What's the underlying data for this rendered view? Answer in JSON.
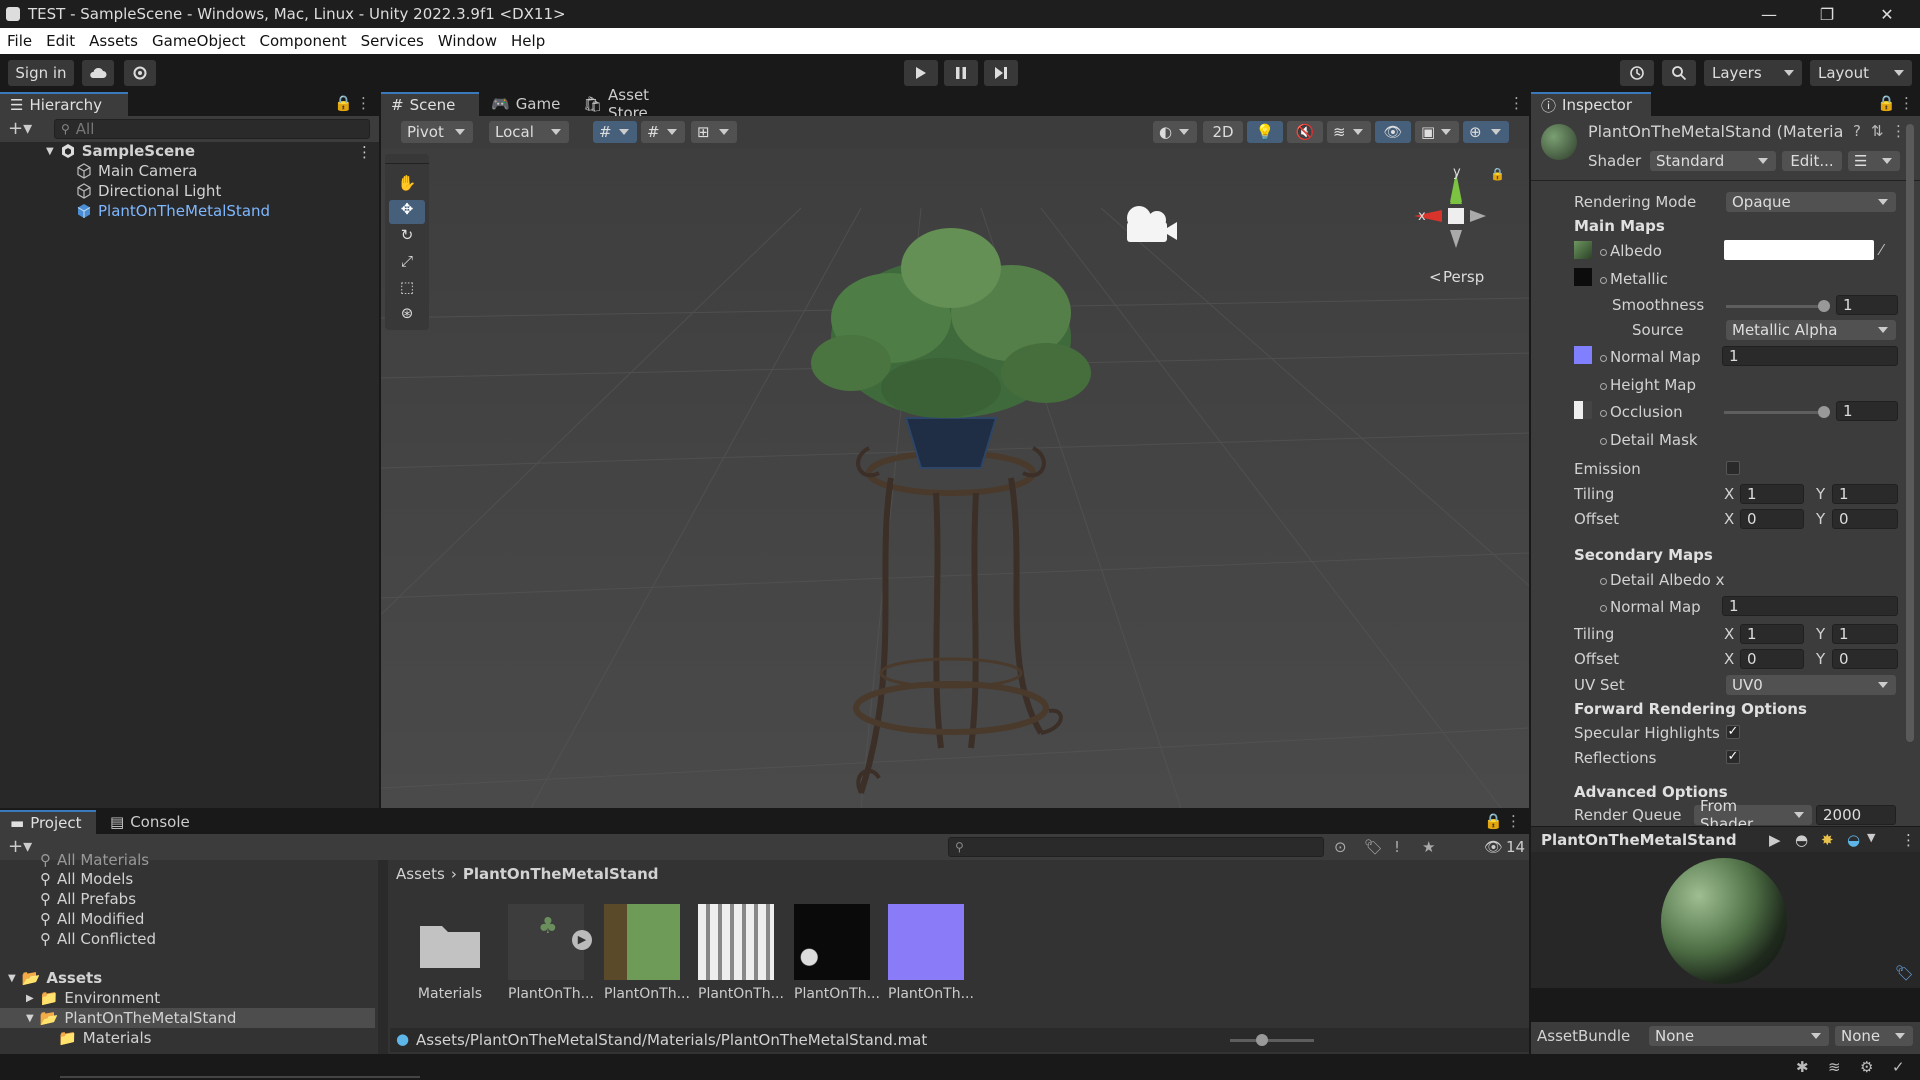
{
  "window": {
    "title": "TEST - SampleScene - Windows, Mac, Linux - Unity 2022.3.9f1 <DX11>",
    "minimize": "—",
    "maximize": "❐",
    "close": "✕"
  },
  "menu": [
    "File",
    "Edit",
    "Assets",
    "GameObject",
    "Component",
    "Services",
    "Window",
    "Help"
  ],
  "toolbar": {
    "sign_in": "Sign in",
    "layers": "Layers",
    "layout": "Layout"
  },
  "hierarchy": {
    "tab": "Hierarchy",
    "search_placeholder": "All",
    "scene": "SampleScene",
    "items": [
      "Main Camera",
      "Directional Light",
      "PlantOnTheMetalStand"
    ]
  },
  "scene": {
    "tabs": [
      "Scene",
      "Game",
      "Asset Store"
    ],
    "pivot": "Pivot",
    "local": "Local",
    "toggle_2d": "2D",
    "persp": "Persp",
    "axis_y": "y",
    "axis_x": "x"
  },
  "inspector": {
    "tab": "Inspector",
    "material_name": "PlantOnTheMetalStand (Materia",
    "shader_label": "Shader",
    "shader_value": "Standard",
    "edit_button": "Edit...",
    "rendering_mode_label": "Rendering Mode",
    "rendering_mode_value": "Opaque",
    "main_maps": "Main Maps",
    "albedo": "Albedo",
    "metallic": "Metallic",
    "smoothness": "Smoothness",
    "smoothness_value": "1",
    "source_label": "Source",
    "source_value": "Metallic Alpha",
    "normal_map": "Normal Map",
    "normal_map_value": "1",
    "height_map": "Height Map",
    "occlusion": "Occlusion",
    "occlusion_value": "1",
    "detail_mask": "Detail Mask",
    "emission": "Emission",
    "tiling": "Tiling",
    "offset": "Offset",
    "x": "X",
    "y": "Y",
    "tiling_x": "1",
    "tiling_y": "1",
    "offset_x": "0",
    "offset_y": "0",
    "secondary_maps": "Secondary Maps",
    "detail_albedo": "Detail Albedo x",
    "normal_map2": "Normal Map",
    "normal_map2_value": "1",
    "tiling2_x": "1",
    "tiling2_y": "1",
    "offset2_x": "0",
    "offset2_y": "0",
    "uv_set_label": "UV Set",
    "uv_set_value": "UV0",
    "forward_rendering": "Forward Rendering Options",
    "specular_highlights": "Specular Highlights",
    "reflections": "Reflections",
    "advanced_options": "Advanced Options",
    "render_queue": "Render Queue",
    "render_queue_source": "From Shader",
    "render_queue_value": "2000",
    "preview_title": "PlantOnTheMetalStand",
    "assetbundle_label": "AssetBundle",
    "assetbundle_value": "None",
    "assetbundle_variant": "None"
  },
  "project": {
    "tabs": [
      "Project",
      "Console"
    ],
    "favorites": [
      "All Materials",
      "All Models",
      "All Prefabs",
      "All Modified",
      "All Conflicted"
    ],
    "tree_root": "Assets",
    "tree": [
      "Environment",
      "PlantOnTheMetalStand",
      "Materials"
    ],
    "breadcrumb_root": "Assets",
    "breadcrumb_current": "PlantOnTheMetalStand",
    "hidden_count": "14",
    "assets": [
      "Materials",
      "PlantOnTh...",
      "PlantOnTh...",
      "PlantOnTh...",
      "PlantOnTh...",
      "PlantOnTh..."
    ],
    "path": "Assets/PlantOnTheMetalStand/Materials/PlantOnTheMetalStand.mat"
  },
  "colors": {
    "accent": "#3a79bb",
    "selected_text": "#7fb7ff",
    "normal_map": "#8080ff"
  }
}
